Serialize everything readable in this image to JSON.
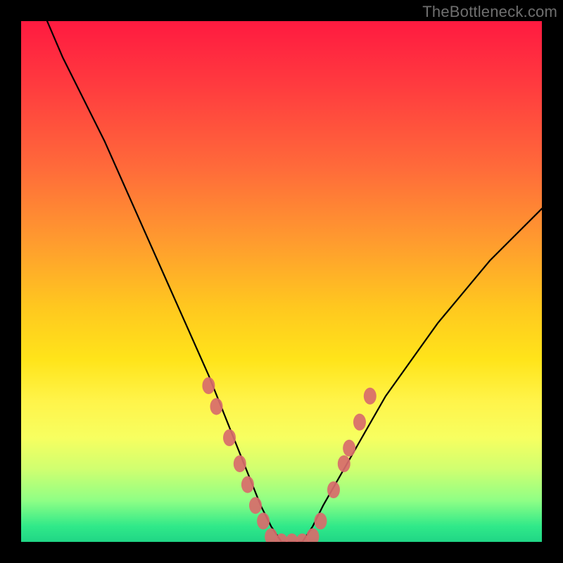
{
  "watermark": "TheBottleneck.com",
  "chart_data": {
    "type": "line",
    "title": "",
    "xlabel": "",
    "ylabel": "",
    "xlim": [
      0,
      100
    ],
    "ylim": [
      0,
      100
    ],
    "grid": false,
    "legend": false,
    "series": [
      {
        "name": "bottleneck-curve",
        "x": [
          5,
          8,
          12,
          16,
          20,
          24,
          28,
          32,
          36,
          40,
          42,
          44,
          46,
          48,
          50,
          52,
          54,
          56,
          58,
          62,
          66,
          70,
          75,
          80,
          85,
          90,
          95,
          100
        ],
        "y": [
          100,
          93,
          85,
          77,
          68,
          59,
          50,
          41,
          32,
          22,
          17,
          12,
          7,
          3,
          0,
          0,
          0,
          3,
          7,
          14,
          21,
          28,
          35,
          42,
          48,
          54,
          59,
          64
        ]
      }
    ],
    "markers": [
      {
        "x": 36,
        "y": 30
      },
      {
        "x": 37.5,
        "y": 26
      },
      {
        "x": 40,
        "y": 20
      },
      {
        "x": 42,
        "y": 15
      },
      {
        "x": 43.5,
        "y": 11
      },
      {
        "x": 45,
        "y": 7
      },
      {
        "x": 46.5,
        "y": 4
      },
      {
        "x": 48,
        "y": 1
      },
      {
        "x": 50,
        "y": 0
      },
      {
        "x": 52,
        "y": 0
      },
      {
        "x": 54,
        "y": 0
      },
      {
        "x": 56,
        "y": 1
      },
      {
        "x": 57.5,
        "y": 4
      },
      {
        "x": 60,
        "y": 10
      },
      {
        "x": 62,
        "y": 15
      },
      {
        "x": 63,
        "y": 18
      },
      {
        "x": 65,
        "y": 23
      },
      {
        "x": 67,
        "y": 28
      }
    ],
    "marker_color": "#d86b6b"
  }
}
